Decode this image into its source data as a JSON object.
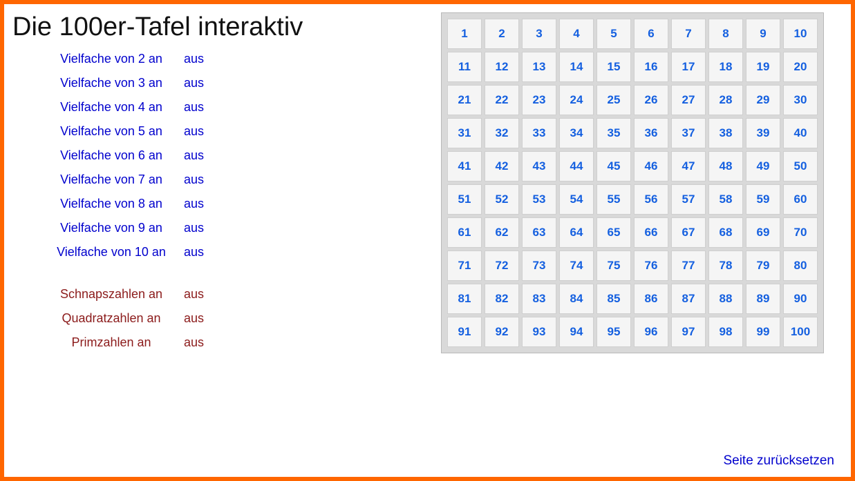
{
  "title": "Die 100er-Tafel interaktiv",
  "off_label": "aus",
  "multiples": [
    {
      "n": 2,
      "on_label": "Vielfache von 2 an"
    },
    {
      "n": 3,
      "on_label": "Vielfache von 3 an"
    },
    {
      "n": 4,
      "on_label": "Vielfache von 4 an"
    },
    {
      "n": 5,
      "on_label": "Vielfache von 5 an"
    },
    {
      "n": 6,
      "on_label": "Vielfache von 6 an"
    },
    {
      "n": 7,
      "on_label": "Vielfache von 7 an"
    },
    {
      "n": 8,
      "on_label": "Vielfache von 8 an"
    },
    {
      "n": 9,
      "on_label": "Vielfache von 9 an"
    },
    {
      "n": 10,
      "on_label": "Vielfache von 10 an"
    }
  ],
  "specials": [
    {
      "key": "schnaps",
      "on_label": "Schnapszahlen an"
    },
    {
      "key": "quadrat",
      "on_label": "Quadratzahlen an"
    },
    {
      "key": "prim",
      "on_label": "Primzahlen an"
    }
  ],
  "grid": {
    "min": 1,
    "max": 100
  },
  "reset_label": "Seite zurücksetzen"
}
